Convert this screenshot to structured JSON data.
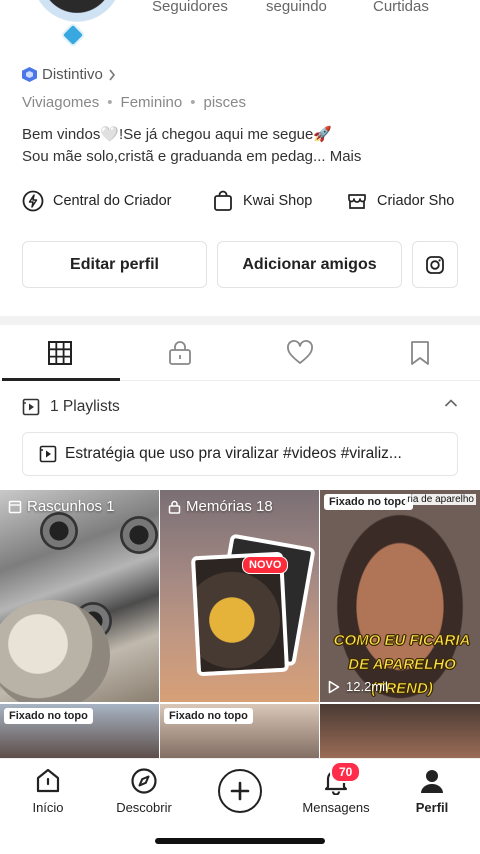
{
  "profile": {
    "stats": {
      "followers_label": "Seguidores",
      "following_label": "seguindo",
      "likes_label": "Curtidas"
    },
    "badge_label": "Distintivo",
    "tags": [
      "Viviagomes",
      "Feminino",
      "pisces"
    ],
    "tag_separator": "•",
    "bio_line1": "Bem vindos🤍!Se já chegou aqui me segue🚀",
    "bio_line2": "Sou mãe solo,cristã e graduanda em pedag...",
    "bio_more": "Mais"
  },
  "creator_links": [
    {
      "label": "Central do Criador",
      "icon": "lightning-circle-icon"
    },
    {
      "label": "Kwai Shop",
      "icon": "shopping-bag-icon"
    },
    {
      "label": "Criador Sho",
      "icon": "store-icon"
    }
  ],
  "buttons": {
    "edit_profile": "Editar perfil",
    "add_friends": "Adicionar amigos",
    "instagram_icon": "instagram-icon"
  },
  "tabs": [
    {
      "name": "grid",
      "icon": "grid-icon",
      "active": true
    },
    {
      "name": "private",
      "icon": "lock-icon",
      "active": false
    },
    {
      "name": "liked",
      "icon": "heart-icon",
      "active": false
    },
    {
      "name": "saved",
      "icon": "bookmark-icon",
      "active": false
    }
  ],
  "playlists": {
    "header": "1 Playlists",
    "item": "Estratégia que uso pra viralizar #videos #viraliz..."
  },
  "grid": {
    "drafts_label": "Rascunhos 1",
    "memories_label": "Memórias 18",
    "novo_badge": "NOVO",
    "pinned_label": "Fixado no topo",
    "video_caption_line1": "COMO EU FICARIA",
    "video_caption_line2": "DE APARELHO",
    "video_caption_line3": "(TREND)",
    "views": "12.2mil",
    "top_text": "ria de aparelho"
  },
  "bottom_nav": [
    {
      "label": "Início",
      "icon": "home-icon",
      "active": false
    },
    {
      "label": "Descobrir",
      "icon": "compass-icon",
      "active": false
    },
    {
      "label": "",
      "icon": "plus-icon",
      "active": false
    },
    {
      "label": "Mensagens",
      "icon": "bell-icon",
      "active": false,
      "badge": "70"
    },
    {
      "label": "Perfil",
      "icon": "user-icon",
      "active": true
    }
  ],
  "colors": {
    "badge_blue": "#4a78e8",
    "notification_red": "#ff2d4a",
    "novo_red": "#ff2b3b",
    "caption_yellow": "#ffe14a"
  }
}
